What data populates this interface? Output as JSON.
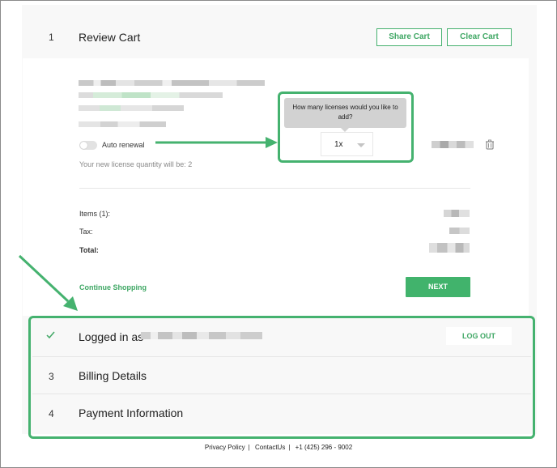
{
  "review": {
    "step": "1",
    "title": "Review Cart",
    "share_label": "Share Cart",
    "clear_label": "Clear Cart"
  },
  "item": {
    "auto_renewal_label": "Auto renewal",
    "license_note": "Your new license quantity will be: 2",
    "tooltip": "How many licenses would you like to add?",
    "quantity": "1x",
    "delete_icon": "trash-icon"
  },
  "summary": {
    "items_label": "Items (1):",
    "tax_label": "Tax:",
    "total_label": "Total:"
  },
  "actions": {
    "continue_label": "Continue Shopping",
    "next_label": "NEXT"
  },
  "steps": {
    "logged_in_label": "Logged in as",
    "logout_label": "LOG OUT",
    "billing_num": "3",
    "billing_title": "Billing Details",
    "payment_num": "4",
    "payment_title": "Payment Information"
  },
  "footer": {
    "privacy": "Privacy Policy",
    "sep1": "|",
    "contact": "ContactUs",
    "sep2": "|",
    "phone": "+1 (425) 296 - 9002"
  },
  "colors": {
    "accent": "#41b36c",
    "highlight": "#45b26f"
  }
}
